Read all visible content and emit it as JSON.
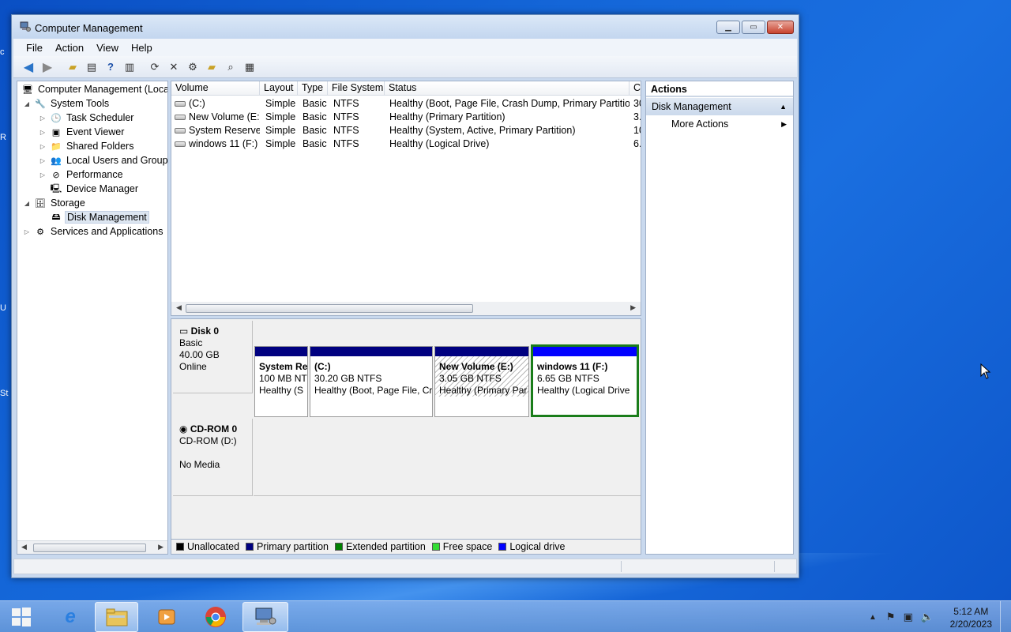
{
  "window": {
    "title": "Computer Management"
  },
  "menu": [
    "File",
    "Action",
    "View",
    "Help"
  ],
  "tree": {
    "root": "Computer Management (Local",
    "system_tools": "System Tools",
    "task_scheduler": "Task Scheduler",
    "event_viewer": "Event Viewer",
    "shared_folders": "Shared Folders",
    "local_users": "Local Users and Groups",
    "performance": "Performance",
    "device_manager": "Device Manager",
    "storage": "Storage",
    "disk_management": "Disk Management",
    "services": "Services and Applications"
  },
  "volume_list": {
    "columns": [
      "Volume",
      "Layout",
      "Type",
      "File System",
      "Status",
      "C"
    ],
    "rows": [
      {
        "volume": "(C:)",
        "layout": "Simple",
        "type": "Basic",
        "fs": "NTFS",
        "status": "Healthy (Boot, Page File, Crash Dump, Primary Partition)",
        "cap": "30"
      },
      {
        "volume": "New Volume (E:)",
        "layout": "Simple",
        "type": "Basic",
        "fs": "NTFS",
        "status": "Healthy (Primary Partition)",
        "cap": "3."
      },
      {
        "volume": "System Reserved",
        "layout": "Simple",
        "type": "Basic",
        "fs": "NTFS",
        "status": "Healthy (System, Active, Primary Partition)",
        "cap": "10"
      },
      {
        "volume": "windows 11  (F:)",
        "layout": "Simple",
        "type": "Basic",
        "fs": "NTFS",
        "status": "Healthy (Logical Drive)",
        "cap": "6."
      }
    ]
  },
  "disks": {
    "disk0": {
      "name": "Disk 0",
      "type": "Basic",
      "size": "40.00 GB",
      "state": "Online"
    },
    "cdrom0": {
      "name": "CD-ROM 0",
      "type": "CD-ROM (D:)",
      "state": "No Media"
    }
  },
  "partitions": [
    {
      "title": "System Re",
      "size": "100 MB NT",
      "status": "Healthy (S"
    },
    {
      "title": "(C:)",
      "size": "30.20 GB NTFS",
      "status": "Healthy (Boot, Page File, Cr"
    },
    {
      "title": "New Volume  (E:)",
      "size": "3.05 GB NTFS",
      "status": "Healthy (Primary Par"
    },
    {
      "title": "windows 11  (F:)",
      "size": "6.65 GB NTFS",
      "status": "Healthy (Logical Drive"
    }
  ],
  "legend": [
    {
      "label": "Unallocated",
      "color": "#000000"
    },
    {
      "label": "Primary partition",
      "color": "#000080"
    },
    {
      "label": "Extended partition",
      "color": "#008000"
    },
    {
      "label": "Free space",
      "color": "#33dd33"
    },
    {
      "label": "Logical drive",
      "color": "#0000ff"
    }
  ],
  "actions": {
    "header": "Actions",
    "section": "Disk Management",
    "more": "More Actions"
  },
  "taskbar": {
    "apps": [
      "start-orb",
      "internet-explorer",
      "file-explorer",
      "media-player",
      "chrome",
      "computer-management"
    ],
    "time": "5:12 AM",
    "date": "2/20/2023"
  },
  "desktop_edge": [
    "c",
    "R",
    "U",
    "St"
  ]
}
